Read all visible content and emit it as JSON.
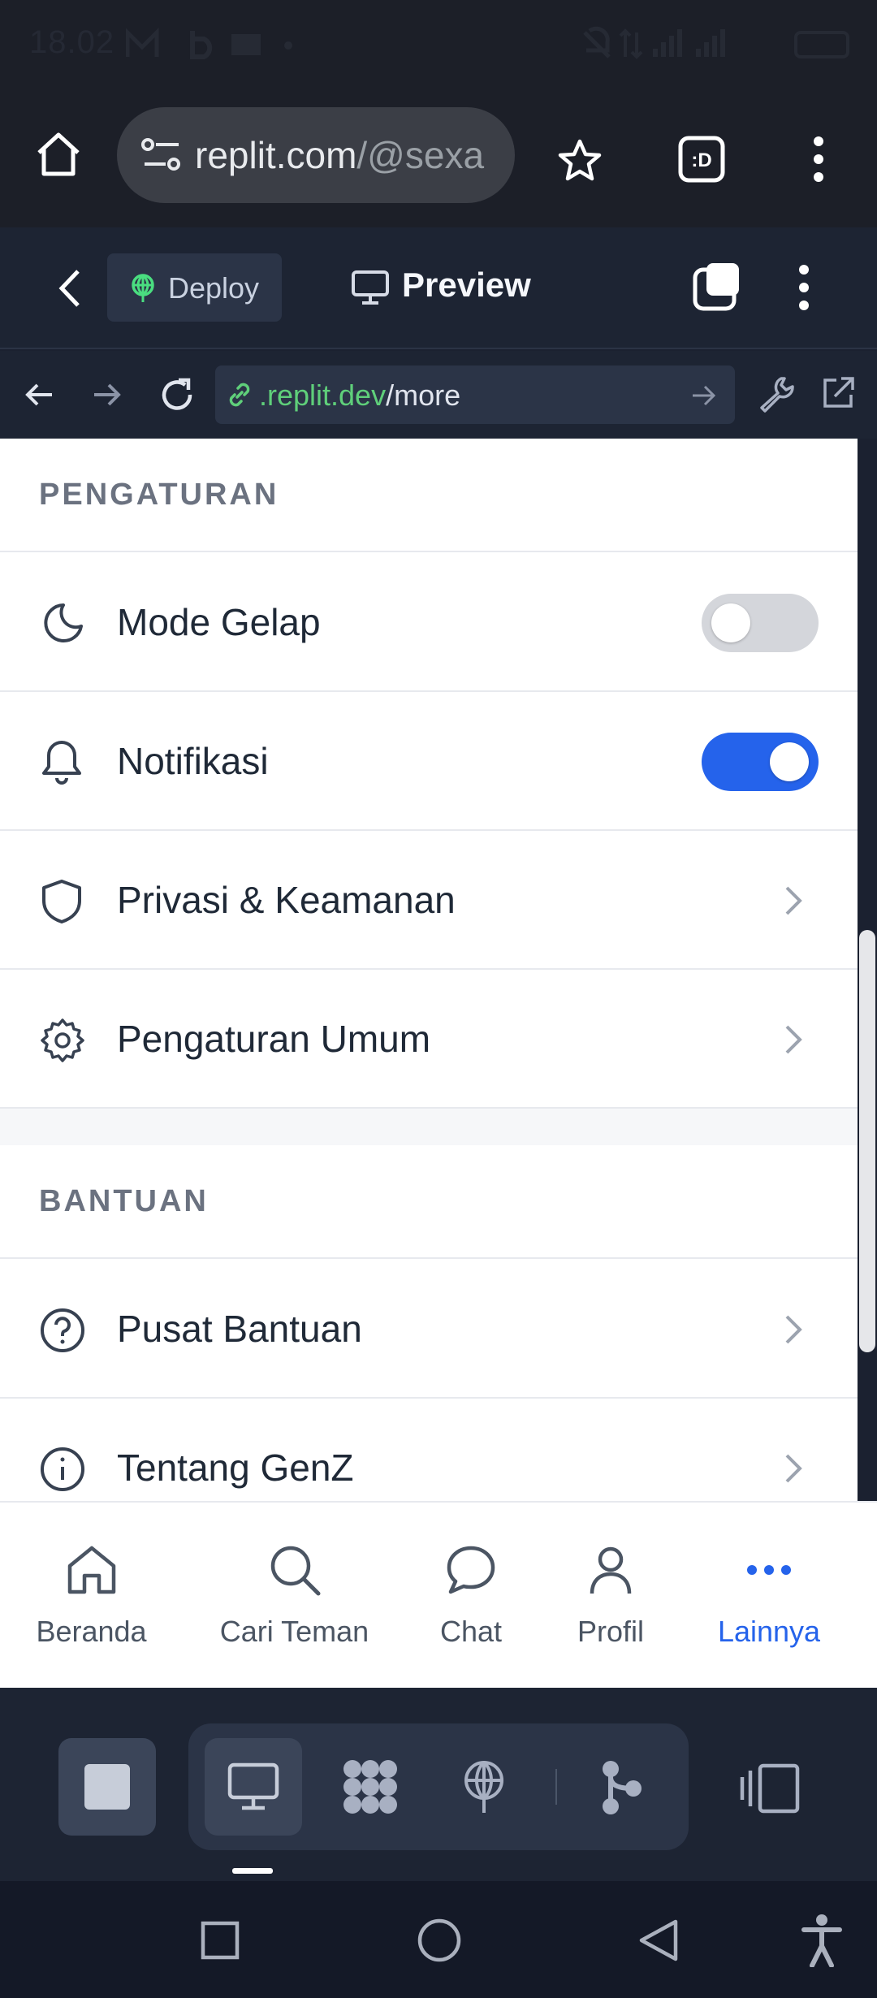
{
  "status_bar": {
    "time": "18.02"
  },
  "browser": {
    "url_host": "replit.com",
    "url_rest": "/@sexa"
  },
  "replit_header": {
    "deploy_label": "Deploy",
    "preview_label": "Preview"
  },
  "dev_bar": {
    "url_host": ".replit.dev",
    "url_path": "/more"
  },
  "sections": {
    "settings": {
      "title": "PENGATURAN",
      "dark_mode": {
        "label": "Mode Gelap",
        "enabled": false
      },
      "notifications": {
        "label": "Notifikasi",
        "enabled": true
      },
      "privacy": {
        "label": "Privasi & Keamanan"
      },
      "general": {
        "label": "Pengaturan Umum"
      }
    },
    "help": {
      "title": "BANTUAN",
      "help_center": {
        "label": "Pusat Bantuan"
      },
      "about": {
        "label": "Tentang GenZ"
      }
    }
  },
  "bottom_nav": {
    "home": "Beranda",
    "search": "Cari Teman",
    "chat": "Chat",
    "profile": "Profil",
    "more": "Lainnya",
    "active": "more"
  },
  "colors": {
    "accent": "#2563eb",
    "toggle_off": "#d4d6db",
    "url_green": "#5fcf7a"
  }
}
